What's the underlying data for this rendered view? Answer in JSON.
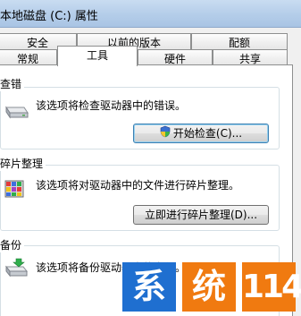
{
  "window": {
    "title": "本地磁盘 (C:) 属性"
  },
  "tabs": {
    "row_back": [
      "安全",
      "以前的版本",
      "配额"
    ],
    "row_front": [
      "常规",
      "工具",
      "硬件",
      "共享"
    ],
    "active": "工具"
  },
  "sections": {
    "check": {
      "title": "查错",
      "description": "该选项将检查驱动器中的错误。",
      "button_label": "开始检查(C)...",
      "icon": "drive-icon"
    },
    "defrag": {
      "title": "碎片整理",
      "description": "该选项将对驱动器中的文件进行碎片整理。",
      "button_label": "立即进行碎片整理(D)...",
      "icon": "defrag-icon"
    },
    "backup": {
      "title": "备份",
      "description": "该选项将备份驱动器中的文件。",
      "icon": "backup-icon"
    }
  },
  "watermark": {
    "chars": [
      "系",
      "统",
      "114"
    ],
    "colors": {
      "blue": "#1f6fd0",
      "orange": "#f07a10"
    }
  }
}
